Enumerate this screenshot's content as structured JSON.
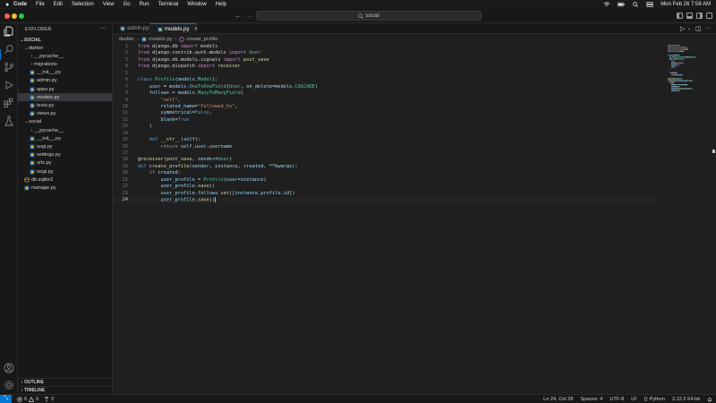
{
  "menubar": {
    "app_name": "Code",
    "items": [
      "File",
      "Edit",
      "Selection",
      "View",
      "Go",
      "Run",
      "Terminal",
      "Window",
      "Help"
    ],
    "clock": "Mon Feb 26  7:58 AM"
  },
  "titlebar": {
    "search_text": "social"
  },
  "sidebar": {
    "title": "EXPLORER",
    "root": "SOCIAL",
    "tree": [
      {
        "label": "dwitter",
        "kind": "folder",
        "open": true,
        "depth": 1
      },
      {
        "label": "__pycache__",
        "kind": "folder",
        "open": false,
        "depth": 2
      },
      {
        "label": "migrations",
        "kind": "folder",
        "open": false,
        "depth": 2
      },
      {
        "label": "__init__.py",
        "kind": "py",
        "depth": 2
      },
      {
        "label": "admin.py",
        "kind": "py",
        "depth": 2
      },
      {
        "label": "apps.py",
        "kind": "py",
        "depth": 2
      },
      {
        "label": "models.py",
        "kind": "py",
        "depth": 2,
        "selected": true
      },
      {
        "label": "tests.py",
        "kind": "py",
        "depth": 2
      },
      {
        "label": "views.py",
        "kind": "py",
        "depth": 2
      },
      {
        "label": "social",
        "kind": "folder",
        "open": true,
        "depth": 1
      },
      {
        "label": "__pycache__",
        "kind": "folder",
        "open": false,
        "depth": 2
      },
      {
        "label": "__init__.py",
        "kind": "py",
        "depth": 2
      },
      {
        "label": "asgi.py",
        "kind": "py",
        "depth": 2
      },
      {
        "label": "settings.py",
        "kind": "py",
        "depth": 2
      },
      {
        "label": "urls.py",
        "kind": "py",
        "depth": 2
      },
      {
        "label": "wsgi.py",
        "kind": "py",
        "depth": 2
      },
      {
        "label": "db.sqlite3",
        "kind": "db",
        "depth": 1
      },
      {
        "label": "manage.py",
        "kind": "py",
        "depth": 1
      }
    ],
    "outline_label": "OUTLINE",
    "timeline_label": "TIMELINE"
  },
  "tabs": [
    {
      "label": "admin.py",
      "active": false
    },
    {
      "label": "models.py",
      "active": true
    }
  ],
  "breadcrumb": {
    "folder": "dwitter",
    "file": "models.py",
    "symbol": "create_profile"
  },
  "editor": {
    "current_line": 24,
    "lines": [
      [
        [
          "kw",
          "from "
        ],
        [
          "id",
          "django.db "
        ],
        [
          "kw",
          "import "
        ],
        [
          "id",
          "models"
        ]
      ],
      [
        [
          "kw",
          "from "
        ],
        [
          "id",
          "django.contrib.auth.models "
        ],
        [
          "kw",
          "import "
        ],
        [
          "cls",
          "User"
        ]
      ],
      [
        [
          "kw",
          "from "
        ],
        [
          "id",
          "django.db.models.signals "
        ],
        [
          "kw",
          "import "
        ],
        [
          "fn",
          "post_save"
        ]
      ],
      [
        [
          "kw",
          "from "
        ],
        [
          "id",
          "django.dispatch "
        ],
        [
          "kw",
          "import "
        ],
        [
          "fn",
          "receiver"
        ]
      ],
      [],
      [
        [
          "kwb",
          "class "
        ],
        [
          "cls",
          "Profile"
        ],
        [
          "id",
          "("
        ],
        [
          "var",
          "models"
        ],
        [
          "id",
          "."
        ],
        [
          "cls",
          "Model"
        ],
        [
          "id",
          "):"
        ]
      ],
      [
        [
          "id",
          "    "
        ],
        [
          "var",
          "user"
        ],
        [
          "id",
          " = "
        ],
        [
          "var",
          "models"
        ],
        [
          "id",
          "."
        ],
        [
          "cls",
          "OneToOneField"
        ],
        [
          "id",
          "("
        ],
        [
          "cls",
          "User"
        ],
        [
          "id",
          ", "
        ],
        [
          "var",
          "on_delete"
        ],
        [
          "id",
          "="
        ],
        [
          "var",
          "models"
        ],
        [
          "id",
          "."
        ],
        [
          "cls",
          "CASCADE"
        ],
        [
          "id",
          ")"
        ]
      ],
      [
        [
          "id",
          "    "
        ],
        [
          "var",
          "follows"
        ],
        [
          "id",
          " = "
        ],
        [
          "var",
          "models"
        ],
        [
          "id",
          "."
        ],
        [
          "cls",
          "ManyToManyField"
        ],
        [
          "id",
          "("
        ]
      ],
      [
        [
          "id",
          "        "
        ],
        [
          "str",
          "\"self\""
        ],
        [
          "id",
          ","
        ]
      ],
      [
        [
          "id",
          "        "
        ],
        [
          "var",
          "related_name"
        ],
        [
          "id",
          "="
        ],
        [
          "str",
          "\"followed_by\""
        ],
        [
          "id",
          ","
        ]
      ],
      [
        [
          "id",
          "        "
        ],
        [
          "var",
          "symmetrical"
        ],
        [
          "id",
          "="
        ],
        [
          "kwb",
          "False"
        ],
        [
          "id",
          ","
        ]
      ],
      [
        [
          "id",
          "        "
        ],
        [
          "var",
          "blank"
        ],
        [
          "id",
          "="
        ],
        [
          "kwb",
          "True"
        ]
      ],
      [
        [
          "id",
          "    )"
        ]
      ],
      [],
      [
        [
          "id",
          "    "
        ],
        [
          "kwb",
          "def "
        ],
        [
          "fn",
          "__str__"
        ],
        [
          "id",
          "("
        ],
        [
          "var",
          "self"
        ],
        [
          "id",
          "):"
        ]
      ],
      [
        [
          "id",
          "        "
        ],
        [
          "kw",
          "return "
        ],
        [
          "var",
          "self"
        ],
        [
          "id",
          "."
        ],
        [
          "var",
          "user"
        ],
        [
          "id",
          "."
        ],
        [
          "var",
          "username"
        ]
      ],
      [],
      [
        [
          "dec",
          "@receiver"
        ],
        [
          "id",
          "("
        ],
        [
          "fn",
          "post_save"
        ],
        [
          "id",
          ", "
        ],
        [
          "var",
          "sender"
        ],
        [
          "id",
          "="
        ],
        [
          "cls",
          "User"
        ],
        [
          "id",
          ")"
        ]
      ],
      [
        [
          "kwb",
          "def "
        ],
        [
          "fn",
          "create_profile"
        ],
        [
          "id",
          "("
        ],
        [
          "var",
          "sender"
        ],
        [
          "id",
          ", "
        ],
        [
          "var",
          "instance"
        ],
        [
          "id",
          ", "
        ],
        [
          "var",
          "created"
        ],
        [
          "id",
          ", **"
        ],
        [
          "var",
          "kwargs"
        ],
        [
          "id",
          "):"
        ]
      ],
      [
        [
          "id",
          "    "
        ],
        [
          "kw",
          "if "
        ],
        [
          "var",
          "created"
        ],
        [
          "id",
          ":"
        ]
      ],
      [
        [
          "id",
          "        "
        ],
        [
          "var",
          "user_profile"
        ],
        [
          "id",
          " = "
        ],
        [
          "cls",
          "Profile"
        ],
        [
          "id",
          "("
        ],
        [
          "var",
          "user"
        ],
        [
          "id",
          "="
        ],
        [
          "var",
          "instance"
        ],
        [
          "id",
          ")"
        ]
      ],
      [
        [
          "id",
          "        "
        ],
        [
          "var",
          "user_profile"
        ],
        [
          "id",
          "."
        ],
        [
          "fn",
          "save"
        ],
        [
          "id",
          "()"
        ]
      ],
      [
        [
          "id",
          "        "
        ],
        [
          "var",
          "user_profile"
        ],
        [
          "id",
          "."
        ],
        [
          "var",
          "follows"
        ],
        [
          "id",
          "."
        ],
        [
          "fn",
          "set"
        ],
        [
          "id",
          "(["
        ],
        [
          "var",
          "instance"
        ],
        [
          "id",
          "."
        ],
        [
          "var",
          "profile"
        ],
        [
          "id",
          "."
        ],
        [
          "var",
          "id"
        ],
        [
          "id",
          "])"
        ]
      ],
      [
        [
          "id",
          "        "
        ],
        [
          "var",
          "user_profile"
        ],
        [
          "id",
          "."
        ],
        [
          "fn",
          "save"
        ],
        [
          "id",
          "()"
        ]
      ]
    ]
  },
  "statusbar": {
    "errors": "0",
    "warnings": "0",
    "ports": "0",
    "position": "Ln 24, Col 28",
    "spaces": "Spaces: 4",
    "encoding": "UTF-8",
    "eol": "LF",
    "language": "Python",
    "interpreter": "3.12.2 64-bit"
  },
  "colors": {
    "accent": "#0078d4",
    "editor_bg": "#1f1f1f",
    "sidebar_bg": "#181818"
  }
}
